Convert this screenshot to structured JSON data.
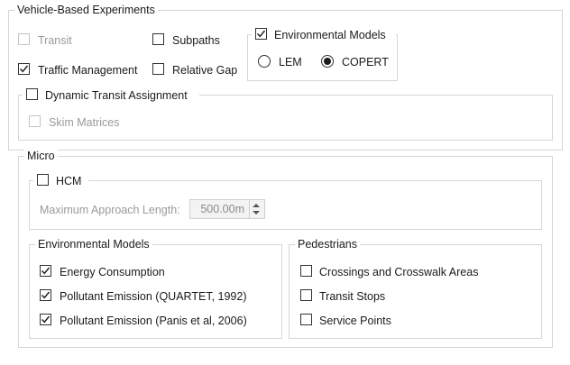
{
  "vehicle": {
    "title": "Vehicle-Based Experiments",
    "transit": {
      "label": "Transit",
      "checked": false,
      "disabled": true
    },
    "subpaths": {
      "label": "Subpaths",
      "checked": false
    },
    "traffic_management": {
      "label": "Traffic Management",
      "checked": true
    },
    "relative_gap": {
      "label": "Relative Gap",
      "checked": false
    },
    "env_models": {
      "label": "Environmental Models",
      "checked": true,
      "lem": {
        "label": "LEM",
        "selected": false
      },
      "copert": {
        "label": "COPERT",
        "selected": true
      }
    },
    "dta": {
      "label": "Dynamic Transit Assignment",
      "checked": false,
      "skim": {
        "label": "Skim Matrices",
        "checked": false,
        "disabled": true
      }
    }
  },
  "micro": {
    "title": "Micro",
    "hcm": {
      "label": "HCM",
      "checked": false,
      "approach_label": "Maximum Approach Length:",
      "approach_value": "500.00m"
    },
    "env": {
      "title": "Environmental Models",
      "energy": {
        "label": "Energy Consumption",
        "checked": true
      },
      "quartet": {
        "label": "Pollutant Emission (QUARTET, 1992)",
        "checked": true
      },
      "panis": {
        "label": "Pollutant Emission (Panis et al, 2006)",
        "checked": true
      }
    },
    "ped": {
      "title": "Pedestrians",
      "crossings": {
        "label": "Crossings and Crosswalk Areas",
        "checked": false
      },
      "transit_stops": {
        "label": "Transit Stops",
        "checked": false
      },
      "service_points": {
        "label": "Service Points",
        "checked": false
      }
    }
  }
}
